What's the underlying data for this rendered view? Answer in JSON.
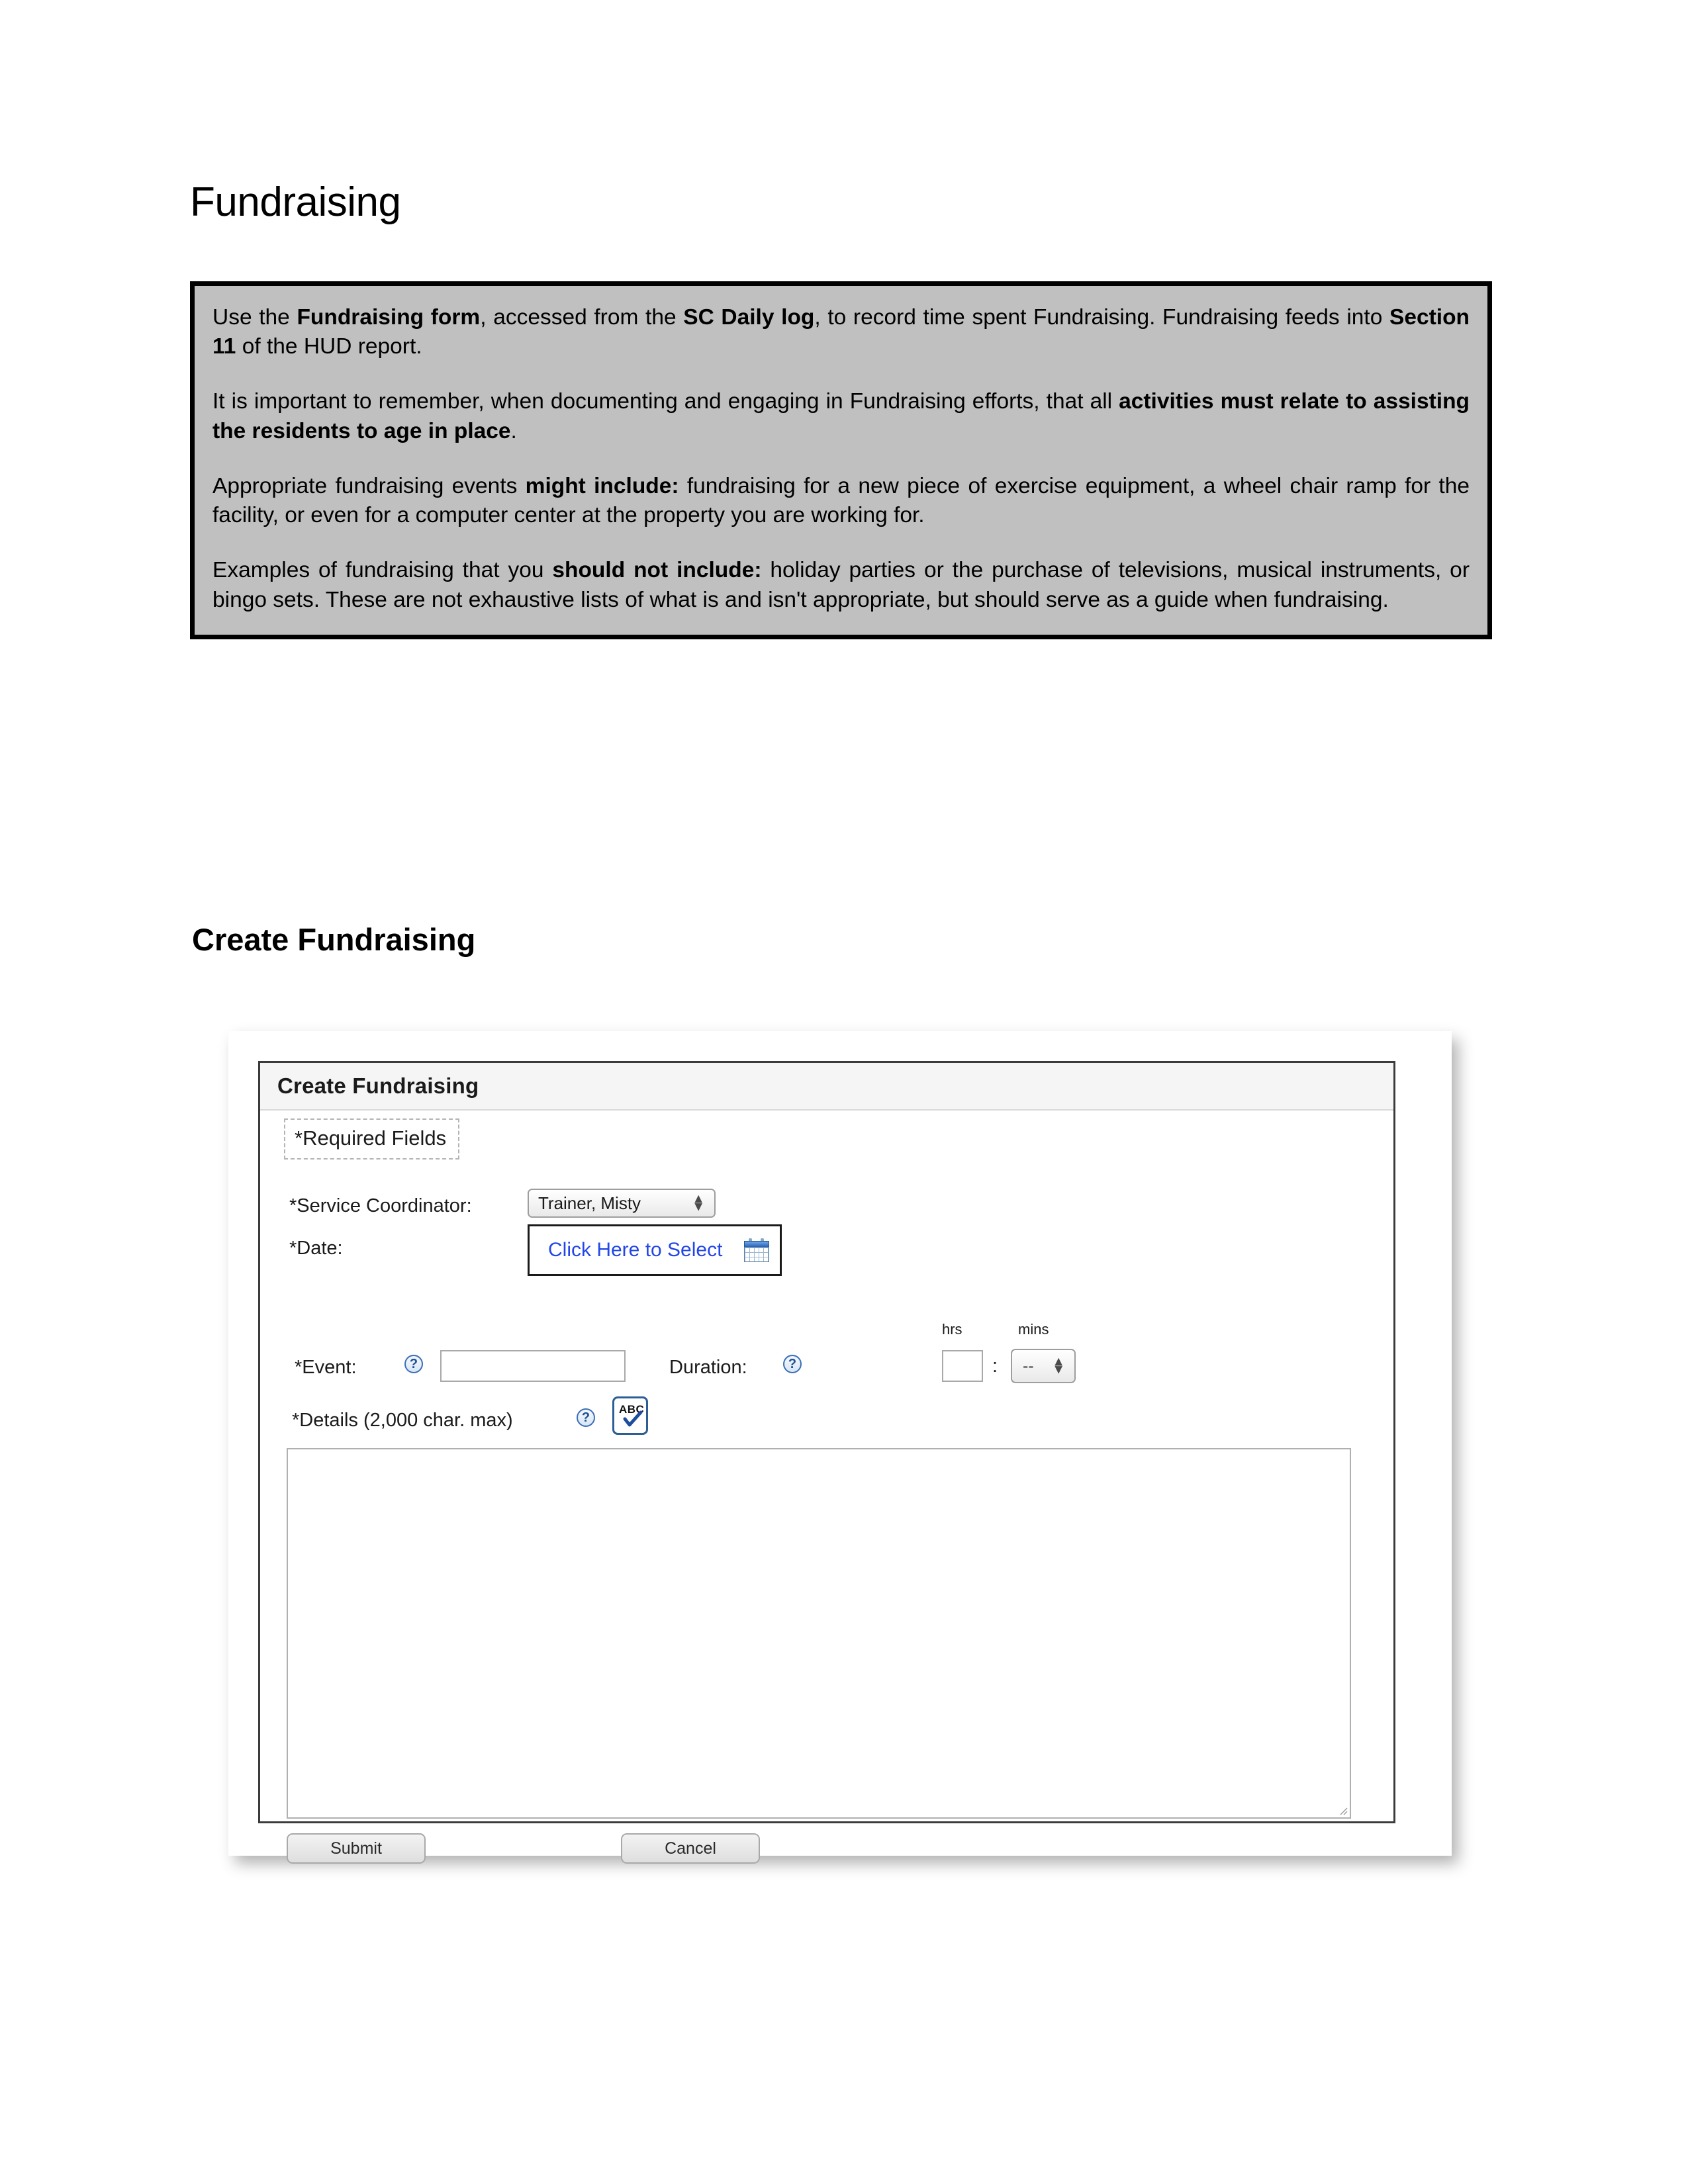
{
  "document": {
    "title": "Fundraising",
    "section_title": "Create Fundraising"
  },
  "callout": {
    "paragraph_1": {
      "part_1": "Use the ",
      "bold_1": "Fundraising form",
      "part_2": ", accessed from the ",
      "bold_2": "SC Daily log",
      "part_3": ", to record time spent Fundraising. Fundraising feeds into ",
      "bold_3": "Section 11",
      "part_4": " of the HUD report."
    },
    "paragraph_2": {
      "part_1": "It is important to remember, when documenting and engaging in Fundraising efforts, that all ",
      "bold_1": "activities must relate to assisting the residents to age in place",
      "part_2": "."
    },
    "paragraph_3": {
      "part_1": "Appropriate fundraising events ",
      "bold_1": "might include:",
      "part_2": " fundraising for a new piece of exercise equipment, a wheel chair ramp for the facility, or even for a computer center at the property you are working for."
    },
    "paragraph_4": {
      "part_1": "Examples of fundraising that you ",
      "bold_1": "should not include:",
      "part_2": " holiday parties or the purchase of televisions, musical instruments, or bingo sets. These are not exhaustive lists of what is and isn't appropriate, but should serve as a guide when fundraising."
    },
    "background_color": "#c0c0c0",
    "border_color": "#000000"
  },
  "form": {
    "header_title": "Create Fundraising",
    "required_fields_note": "*Required Fields",
    "service_coordinator": {
      "label": "*Service Coordinator:",
      "value": "Trainer, Misty"
    },
    "date": {
      "label": "*Date:",
      "button_text": "Click Here to Select",
      "icon": "calendar-icon",
      "link_color": "#2346e8"
    },
    "event": {
      "label": "*Event:",
      "value": "",
      "help_icon": "?"
    },
    "duration": {
      "label": "Duration:",
      "help_icon": "?",
      "hrs_label": "hrs",
      "mins_label": "mins",
      "hrs_value": "",
      "mins_value": "--",
      "separator": ":"
    },
    "details": {
      "label": "*Details (2,000 char. max)",
      "help_icon": "?",
      "spellcheck_icon_text": "ABC",
      "value": ""
    },
    "buttons": {
      "submit": "Submit",
      "cancel": "Cancel"
    }
  }
}
